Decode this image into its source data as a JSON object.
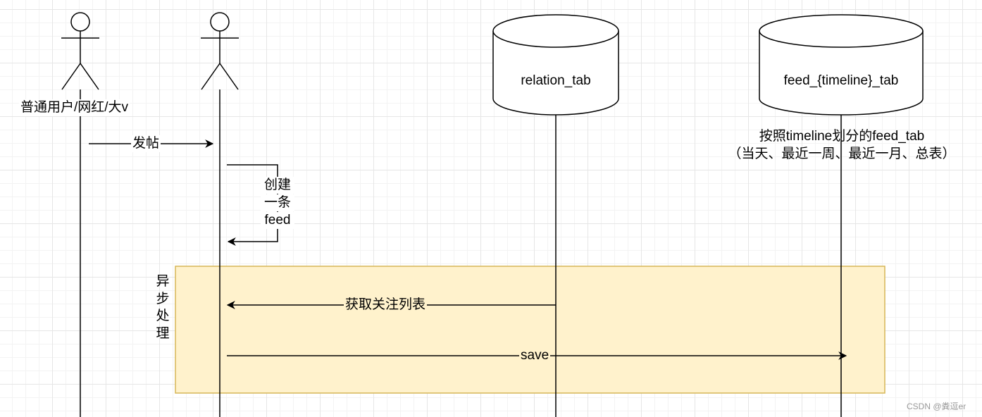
{
  "actors": {
    "user": "普通用户/网红/大v"
  },
  "databases": {
    "relation": "relation_tab",
    "feed": "feed_{timeline}_tab"
  },
  "notes": {
    "feed_line1": "按照timeline划分的feed_tab",
    "feed_line2": "（当天、最近一周、最近一月、总表）"
  },
  "messages": {
    "post": "发帖",
    "self_line1": "创建",
    "self_line2": "一条",
    "self_line3": "feed",
    "get_follow": "获取关注列表",
    "save": "save"
  },
  "group": {
    "label": "异步处理"
  },
  "watermark": "CSDN @粪逗er",
  "colors": {
    "group_fill": "#fff2cc",
    "group_stroke": "#d6b656",
    "grid": "#e6e6e6",
    "line": "#000000"
  }
}
